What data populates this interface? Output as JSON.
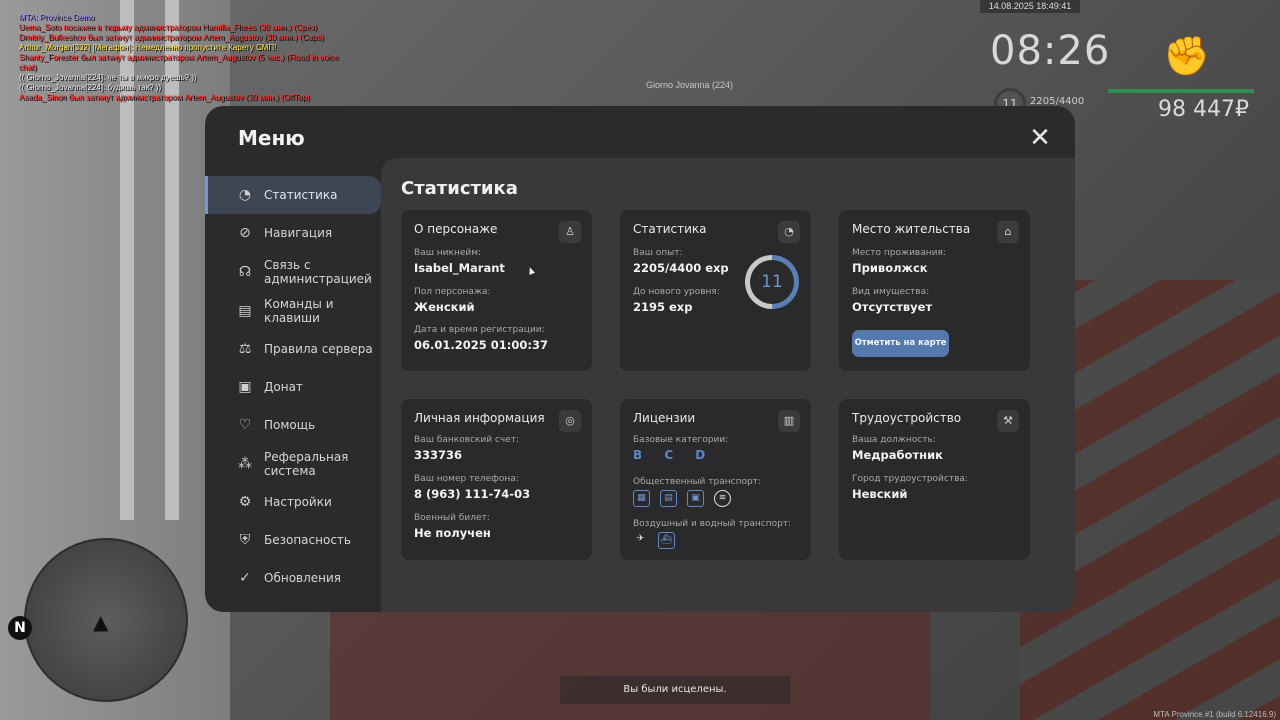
{
  "chat": [
    {
      "text": "MTA: Province Demo",
      "color": "#9a8cff"
    },
    {
      "text": "Uema_Soto посажен в тюрьму администратором Hamilla_Flores (30 мин.) (Срез)",
      "color": "#ff2b2b"
    },
    {
      "text": "Dmitriy_Bulkeshov был заткнут администратором Artem_Augustov (30 мин.) (Caps)",
      "color": "#ff2b2b"
    },
    {
      "text": "Arthur_Morgan[332] [Мегафон]: Немедленно пропустите Карету СМП!",
      "color": "#ffe14d"
    },
    {
      "text": "Shanty_Forester был заткнут администратором Artem_Augustov (5 час.) (Flood in voice chat)",
      "color": "#ff2b2b"
    },
    {
      "text": "(( Giorno_Jovanna[224]: че ты в микро дуешь? ))",
      "color": "#e6e6e6"
    },
    {
      "text": "(( Giorno_Jovanna[224]: будишь так? ))",
      "color": "#e6e6e6"
    },
    {
      "text": "Asada_Sinon был заткнут администратором Artem_Augustov (30 мин.) (OffTop)",
      "color": "#ff2b2b"
    }
  ],
  "player_tag": "Giorno Jovanna (224)",
  "hud": {
    "datetime": "14.08.2025 18:49:41",
    "clock": "08:26",
    "level": "11",
    "exp": "2205/4400",
    "money": "98 447₽"
  },
  "toast": "Вы были исцелены.",
  "version": "MTA Province #1 (build 6.12416.9)",
  "menu": {
    "title": "Меню",
    "close": "✕",
    "nav": [
      {
        "label": "Статистика",
        "icon": "◔"
      },
      {
        "label": "Навигация",
        "icon": "⊘"
      },
      {
        "label": "Связь с администрацией",
        "icon": "☊"
      },
      {
        "label": "Команды и клавиши",
        "icon": "▤"
      },
      {
        "label": "Правила сервера",
        "icon": "⚖"
      },
      {
        "label": "Донат",
        "icon": "▣"
      },
      {
        "label": "Помощь",
        "icon": "♡"
      },
      {
        "label": "Реферальная система",
        "icon": "⁂"
      },
      {
        "label": "Настройки",
        "icon": "⚙"
      },
      {
        "label": "Безопасность",
        "icon": "⛨"
      },
      {
        "label": "Обновления",
        "icon": "✓"
      }
    ]
  },
  "stats": {
    "title": "Статистика",
    "character": {
      "title": "О персонаже",
      "nick_label": "Ваш никнейм:",
      "nick": "Isabel_Marant",
      "gender_label": "Пол персонажа:",
      "gender": "Женский",
      "reg_label": "Дата и время регистрации:",
      "reg": "06.01.2025 01:00:37"
    },
    "statistics": {
      "title": "Статистика",
      "exp_label": "Ваш опыт:",
      "exp": "2205/4400 exp",
      "next_label": "До нового уровня:",
      "next": "2195 exp",
      "level": "11",
      "progress": 0.501
    },
    "residence": {
      "title": "Место жительства",
      "place_label": "Место проживания:",
      "place": "Приволжск",
      "property_label": "Вид имущества:",
      "property": "Отсутствует",
      "button": "Отметить на карте"
    },
    "personal": {
      "title": "Личная информация",
      "bank_label": "Ваш банковский счет:",
      "bank": "333736",
      "phone_label": "Ваш номер телефона:",
      "phone": "8 (963) 111-74-03",
      "military_label": "Военный билет:",
      "military": "Не получен"
    },
    "licenses": {
      "title": "Лицензии",
      "base_label": "Базовые категории:",
      "base": "B C D",
      "public_label": "Общественный транспорт:",
      "air_label": "Воздушный и водный транспорт:"
    },
    "employment": {
      "title": "Трудоустройство",
      "position_label": "Ваша должность:",
      "position": "Медработник",
      "city_label": "Город трудоустройства:",
      "city": "Невский"
    }
  }
}
